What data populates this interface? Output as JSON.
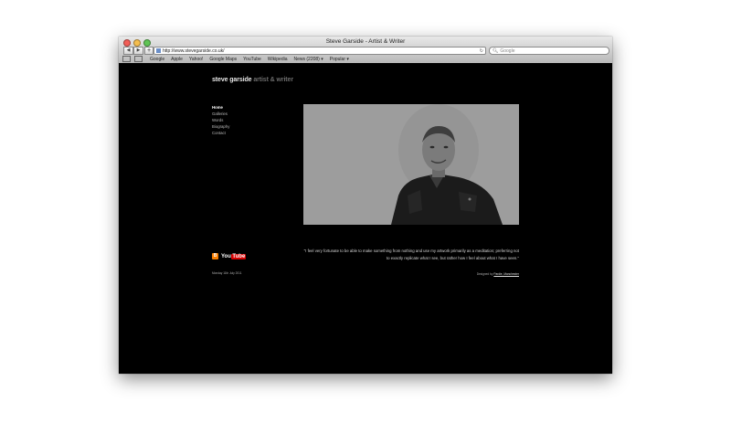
{
  "window": {
    "title": "Steve Garside - Artist & Writer"
  },
  "toolbar": {
    "back_label": "◀",
    "forward_label": "▶",
    "add_label": "+",
    "url": "http://www.stevegarside.co.uk/",
    "search_placeholder": "Google"
  },
  "bookmarks": [
    "Google",
    "Apple",
    "Yahoo!",
    "Google Maps",
    "YouTube",
    "Wikipedia",
    "News (2208) ▾",
    "Popular ▾"
  ],
  "site": {
    "name": "steve garside",
    "tagline": "artist & writer",
    "nav": [
      "Home",
      "Galleries",
      "Words",
      "Biography",
      "Contact"
    ],
    "quote": "\"I feel very fortunate to be able to make something from nothing and use my artwork primarily as a meditation; preferring not to exactly replicate what I see, but rather how I feel about what I have seen.\"",
    "date": "Monday 11th July 2011",
    "credit_prefix": "Designed by",
    "credit_link": "Pardie, Manchester"
  },
  "social": {
    "youtube_you": "You",
    "youtube_tube": "Tube"
  }
}
